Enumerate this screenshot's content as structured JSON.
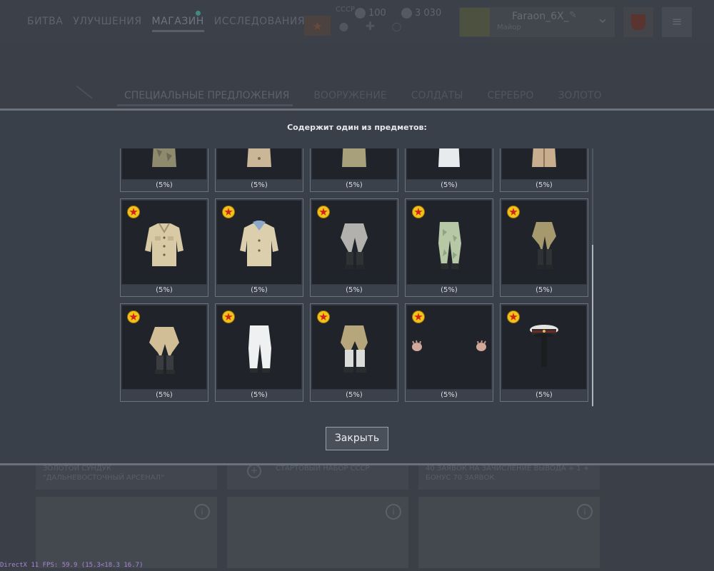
{
  "top_nav": {
    "items": [
      "БИТВА",
      "УЛУЧШЕНИЯ",
      "МАГАЗИН",
      "ИССЛЕДОВАНИЯ"
    ],
    "active": "МАГАЗИН"
  },
  "header": {
    "country_label": "СССР",
    "currency_1": "100",
    "currency_2": "3 030",
    "player_name": "Faraon_6X_",
    "player_rank": "Майор"
  },
  "shop_tabs": [
    "СПЕЦИАЛЬНЫЕ ПРЕДЛОЖЕНИЯ",
    "ВООРУЖЕНИЕ",
    "СОЛДАТЫ",
    "СЕРЕБРО",
    "ЗОЛОТО"
  ],
  "modal": {
    "title": "Содержит один из предметов:",
    "close_label": "Закрыть",
    "items": [
      {
        "name": "camo-jacket",
        "chance": "(5%)",
        "starred": false
      },
      {
        "name": "beige-jacket",
        "chance": "(5%)",
        "starred": false
      },
      {
        "name": "khaki-jacket",
        "chance": "(5%)",
        "starred": false
      },
      {
        "name": "white-jacket",
        "chance": "(5%)",
        "starred": false
      },
      {
        "name": "tan-coat",
        "chance": "(5%)",
        "starred": false
      },
      {
        "name": "beige-tunic",
        "chance": "(5%)",
        "starred": true
      },
      {
        "name": "beige-tunic-blue-collar",
        "chance": "(5%)",
        "starred": true
      },
      {
        "name": "grey-breeches",
        "chance": "(5%)",
        "starred": true
      },
      {
        "name": "green-camo-pants",
        "chance": "(5%)",
        "starred": true
      },
      {
        "name": "khaki-breeches",
        "chance": "(5%)",
        "starred": true
      },
      {
        "name": "tan-breeches",
        "chance": "(5%)",
        "starred": true
      },
      {
        "name": "white-pants",
        "chance": "(5%)",
        "starred": true
      },
      {
        "name": "khaki-pants-gaiters",
        "chance": "(5%)",
        "starred": true
      },
      {
        "name": "gloves",
        "chance": "(5%)",
        "starred": true
      },
      {
        "name": "peaked-cap",
        "chance": "(5%)",
        "starred": true
      }
    ]
  },
  "bg_cards": [
    {
      "title": "ЗОЛОТОЙ СУНДУК\n\"ДАЛЬНЕВОСТОЧНЫЙ АРСЕНАЛ\""
    },
    {
      "title": "СТАРТОВЫЙ НАБОР СССР"
    },
    {
      "title": "40 ЗАЯВОК НА ЗАЧИСЛЕНИЕ ВЫВОДА + 1 +\nБОНУС 70 ЗАЯВОК"
    }
  ],
  "fps_text": "DirectX 11 FPS: 59.9 (15.3<18.3 16.7)"
}
